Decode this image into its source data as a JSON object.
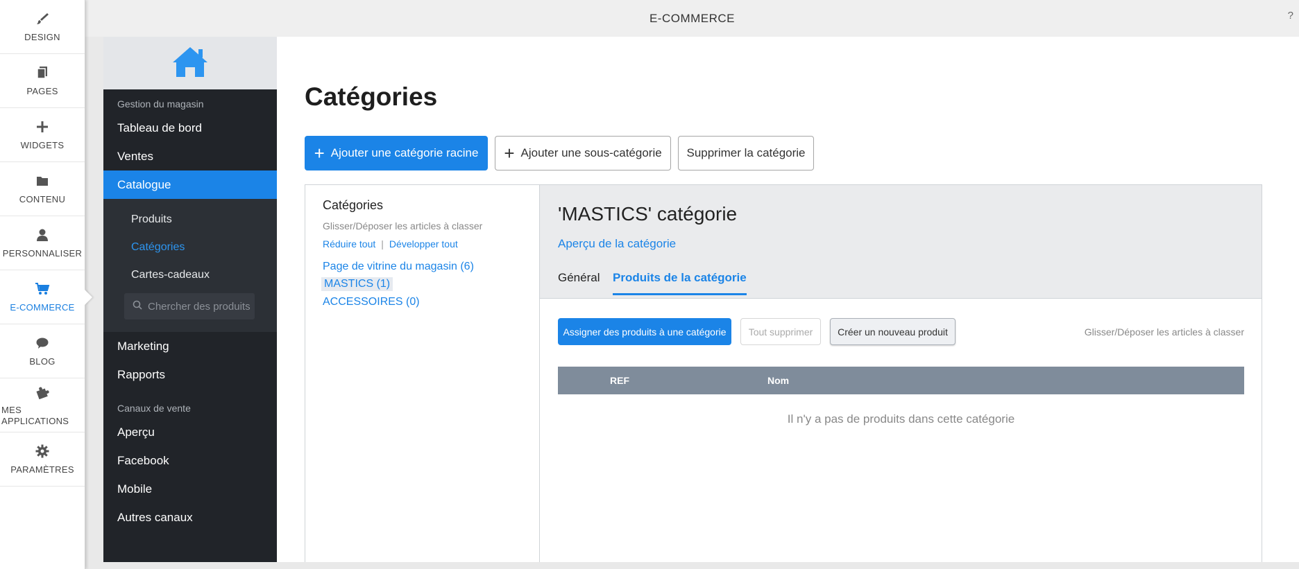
{
  "rail": {
    "items": [
      {
        "label": "DESIGN",
        "icon": "brush-icon"
      },
      {
        "label": "PAGES",
        "icon": "pages-icon"
      },
      {
        "label": "WIDGETS",
        "icon": "plus-icon"
      },
      {
        "label": "CONTENU",
        "icon": "folder-icon"
      },
      {
        "label": "PERSONNALISER",
        "icon": "user-icon"
      },
      {
        "label": "E-COMMERCE",
        "icon": "cart-icon"
      },
      {
        "label": "BLOG",
        "icon": "chat-icon"
      },
      {
        "label": "MES APPLICATIONS",
        "icon": "puzzle-icon"
      },
      {
        "label": "PARAMÈTRES",
        "icon": "gear-icon"
      }
    ]
  },
  "topbar": {
    "title": "E-COMMERCE",
    "help": "?"
  },
  "store": {
    "section_manage": "Gestion du magasin",
    "nav": {
      "dashboard": "Tableau de bord",
      "sales": "Ventes",
      "catalog": "Catalogue",
      "marketing": "Marketing",
      "reports": "Rapports"
    },
    "sub": {
      "products": "Produits",
      "categories": "Catégories",
      "gift_cards": "Cartes-cadeaux",
      "search_placeholder": "Chercher des produits"
    },
    "section_channels": "Canaux de vente",
    "channels": {
      "overview": "Aperçu",
      "facebook": "Facebook",
      "mobile": "Mobile",
      "other": "Autres canaux"
    }
  },
  "main": {
    "title": "Catégories",
    "buttons": {
      "add_root": "Ajouter une catégorie racine",
      "add_sub": "Ajouter une sous-catégorie",
      "delete": "Supprimer la catégorie"
    },
    "tree": {
      "title": "Catégories",
      "hint": "Glisser/Déposer les articles à classer",
      "collapse": "Réduire tout",
      "separator": "|",
      "expand": "Développer tout",
      "nodes": [
        "Page de vitrine du magasin (6)",
        "MASTICS (1)",
        "ACCESSOIRES (0)"
      ]
    },
    "detail": {
      "title": "'MASTICS' catégorie",
      "preview": "Aperçu de la catégorie",
      "tabs": {
        "general": "Général",
        "products": "Produits de la catégorie"
      },
      "buttons": {
        "assign": "Assigner des produits à une catégorie",
        "delete_all": "Tout supprimer",
        "create": "Créer un nouveau produit"
      },
      "hint": "Glisser/Déposer les articles à classer",
      "table": {
        "col_ref": "REF",
        "col_name": "Nom"
      },
      "empty": "Il n'y a pas de produits dans cette catégorie"
    }
  },
  "colors": {
    "accent": "#1b84e7",
    "sidebar_dark": "#212429",
    "table_header": "#7f8c9b"
  }
}
